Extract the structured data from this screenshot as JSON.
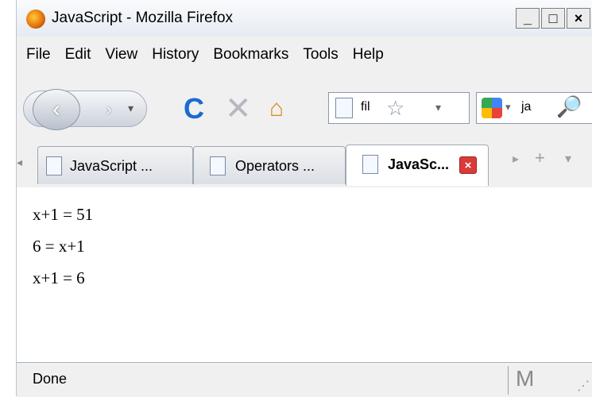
{
  "window": {
    "title": "JavaScript - Mozilla Firefox",
    "min": "_",
    "max": "□",
    "close": "×"
  },
  "menu": [
    "File",
    "Edit",
    "View",
    "History",
    "Bookmarks",
    "Tools",
    "Help"
  ],
  "nav": {
    "back": "‹",
    "forward": "›",
    "dropdown": "▾",
    "reload": "C",
    "stop": "✕",
    "home": "⌂"
  },
  "url": {
    "value": "fil",
    "star": "☆",
    "dropdown": "▾"
  },
  "search": {
    "dropdown": "▾",
    "value": "ja",
    "icon": "🔎"
  },
  "tabs": {
    "scroll_left": "◂",
    "items": [
      {
        "label": "JavaScript ...",
        "active": false
      },
      {
        "label": "Operators ...",
        "active": false
      },
      {
        "label": "JavaSc...",
        "active": true
      }
    ],
    "close": "×",
    "scroll_right": "▸",
    "new_tab": "+",
    "list": "▾"
  },
  "content": {
    "lines": [
      "x+1 = 51",
      "6 = x+1",
      "x+1 = 6"
    ]
  },
  "status": {
    "text": "Done",
    "mail": "M",
    "grip": "⋰"
  }
}
